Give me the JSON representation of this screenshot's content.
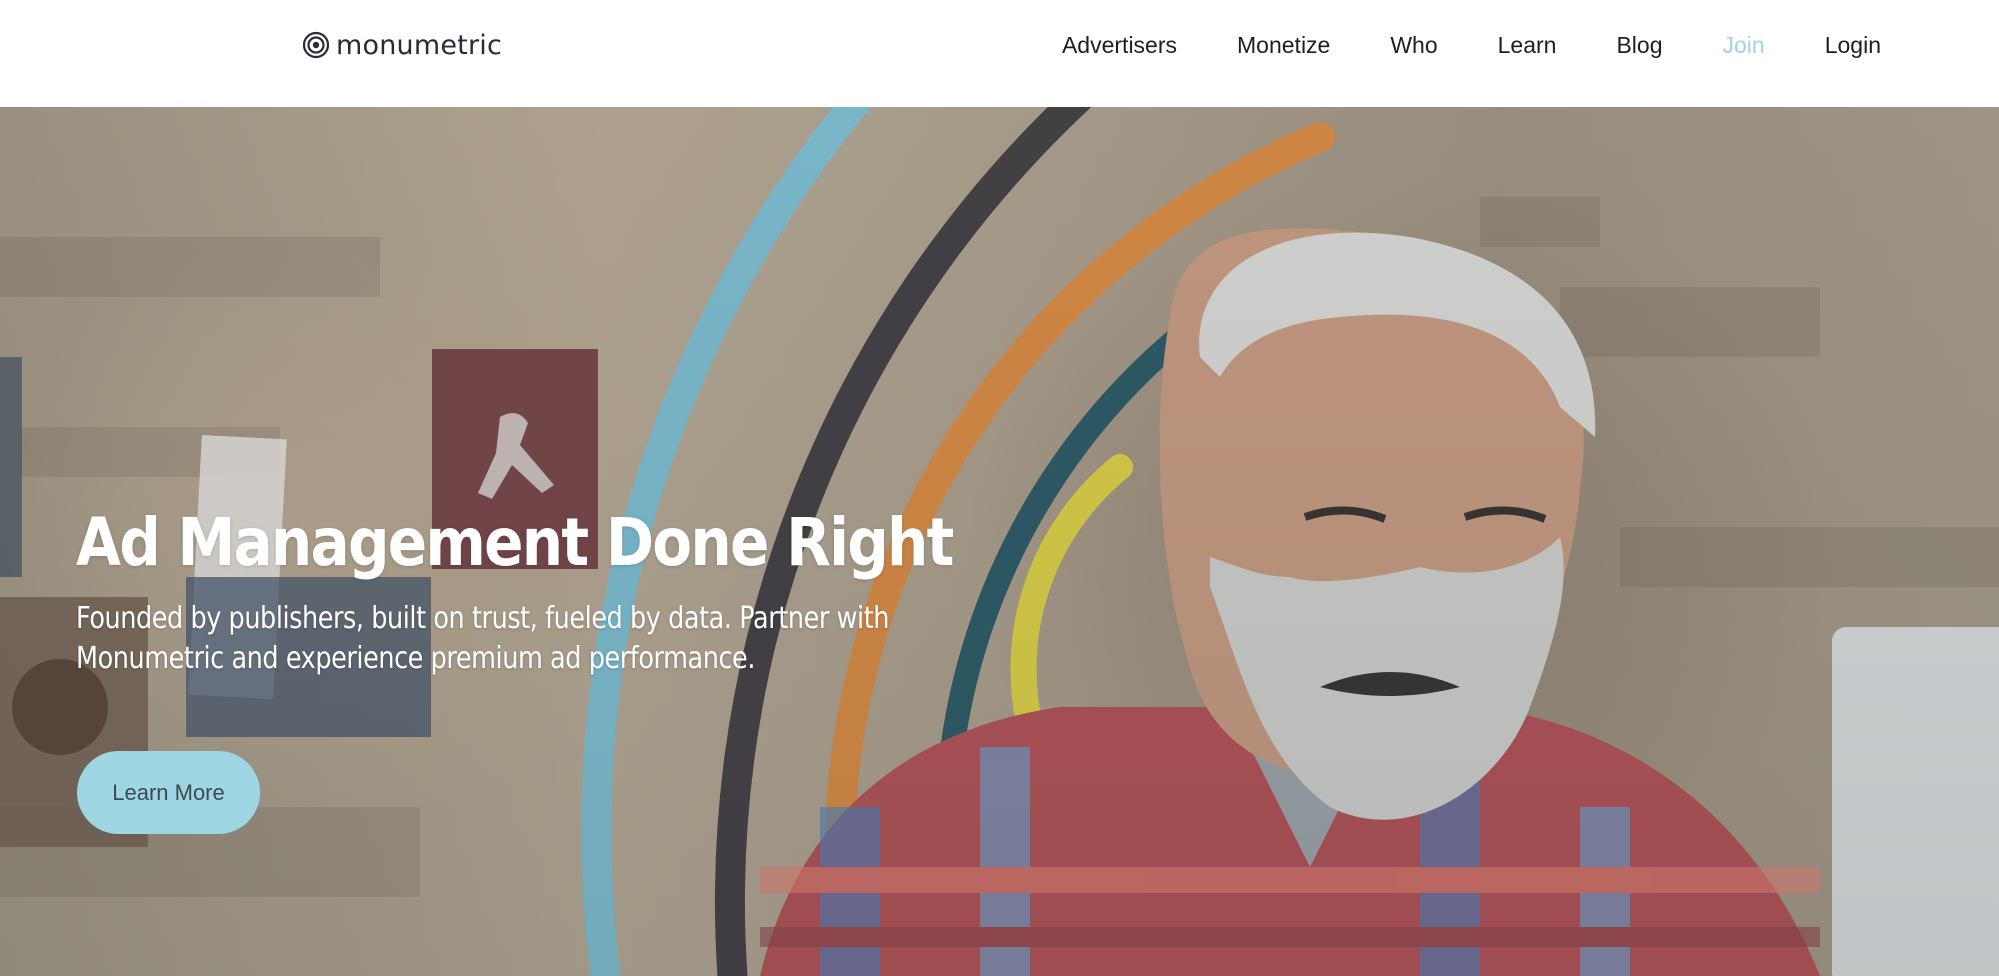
{
  "header": {
    "logo_text": "monumetric",
    "logo_icon": "concentric-circles-icon",
    "nav": [
      {
        "label": "Advertisers"
      },
      {
        "label": "Monetize"
      },
      {
        "label": "Who"
      },
      {
        "label": "Learn"
      },
      {
        "label": "Blog"
      },
      {
        "label": "Join"
      },
      {
        "label": "Login"
      }
    ]
  },
  "hero": {
    "title": "Ad Management Done Right",
    "subtitle_line1": "Founded by publishers, built on trust, fueled by data. Partner with",
    "subtitle_line2": "Monumetric and experience premium ad performance.",
    "cta_label": "Learn More"
  },
  "colors": {
    "accent": "#9fd6e3",
    "join_link": "#9fd4e0",
    "arc_light_blue": "#79bcd0",
    "arc_dark": "#3d383d",
    "arc_orange": "#d9873c",
    "arc_teal": "#24535f",
    "arc_yellow": "#dcd03e"
  }
}
